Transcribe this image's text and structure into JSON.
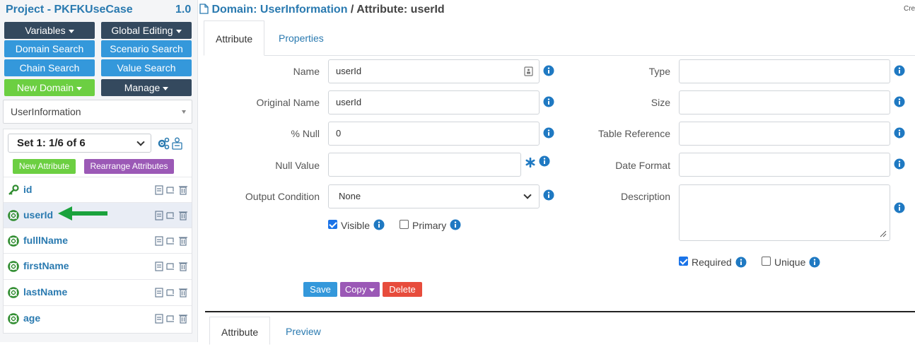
{
  "project": {
    "title": "Project - PKFKUseCase",
    "version": "1.0"
  },
  "toolbar": {
    "variables": "Variables",
    "global_editing": "Global Editing",
    "domain_search": "Domain Search",
    "scenario_search": "Scenario Search",
    "chain_search": "Chain Search",
    "value_search": "Value Search",
    "new_domain": "New Domain",
    "manage": "Manage"
  },
  "domain_select": {
    "value": "UserInformation"
  },
  "set_select": {
    "value": "Set 1: 1/6 of 6"
  },
  "attr_buttons": {
    "new_attribute": "New Attribute",
    "rearrange": "Rearrange Attributes"
  },
  "attributes": [
    {
      "name": "id",
      "icon": "key-icon"
    },
    {
      "name": "userId",
      "icon": "lifebuoy-icon"
    },
    {
      "name": "fulllName",
      "icon": "lifebuoy-icon"
    },
    {
      "name": "firstName",
      "icon": "lifebuoy-icon"
    },
    {
      "name": "lastName",
      "icon": "lifebuoy-icon"
    },
    {
      "name": "age",
      "icon": "lifebuoy-icon"
    }
  ],
  "breadcrumb": {
    "domain": "Domain: UserInformation",
    "separator": "/",
    "attribute": "Attribute: userId"
  },
  "header_right": "Cre",
  "tabs_top": [
    "Attribute",
    "Properties"
  ],
  "form": {
    "name_label": "Name",
    "name_value": "userId",
    "original_name_label": "Original Name",
    "original_name_value": "userId",
    "null_pct_label": "% Null",
    "null_pct_value": "0",
    "null_value_label": "Null Value",
    "null_value_value": "",
    "output_condition_label": "Output Condition",
    "output_condition_value": "None",
    "visible_label": "Visible",
    "primary_label": "Primary",
    "type_label": "Type",
    "type_value": "",
    "size_label": "Size",
    "size_value": "",
    "table_reference_label": "Table Reference",
    "table_reference_value": "",
    "date_format_label": "Date Format",
    "date_format_value": "",
    "description_label": "Description",
    "description_value": "",
    "required_label": "Required",
    "unique_label": "Unique",
    "checks": {
      "visible": true,
      "primary": false,
      "required": true,
      "unique": false
    }
  },
  "actions": {
    "save": "Save",
    "copy": "Copy",
    "delete": "Delete"
  },
  "tabs_bottom": [
    "Attribute",
    "Preview"
  ],
  "colors": {
    "dark_btn": "#34495e",
    "blue_btn": "#3498db",
    "green_btn": "#6ccf42",
    "purple_btn": "#9b59b6",
    "red_btn": "#e74c3c",
    "link": "#2a7ab0",
    "arrow": "#1aa23c"
  }
}
